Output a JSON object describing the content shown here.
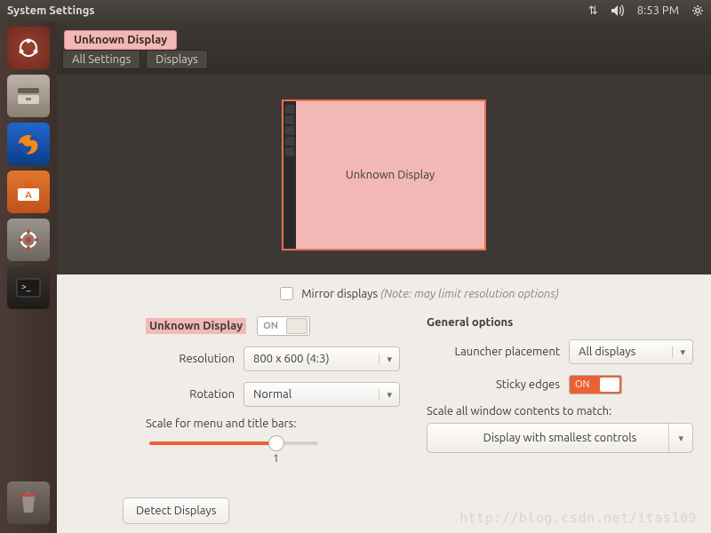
{
  "menubar": {
    "title": "System Settings",
    "time": "8:53 PM"
  },
  "launcher": {
    "items": [
      "dash",
      "files",
      "firefox",
      "software",
      "settings",
      "terminal"
    ],
    "trash": "trash"
  },
  "window": {
    "badge": "Unknown Display",
    "ghost_title": "Displays",
    "crumbs": [
      "All Settings",
      "Displays"
    ]
  },
  "preview": {
    "display_label": "Unknown Display"
  },
  "mirror": {
    "label": "Mirror displays",
    "note": "(Note: may limit resolution options)"
  },
  "left": {
    "display_name": "Unknown Display",
    "power": "ON",
    "resolution_label": "Resolution",
    "resolution_value": "800 x 600 (4:3)",
    "rotation_label": "Rotation",
    "rotation_value": "Normal",
    "scale_label": "Scale for menu and title bars:",
    "scale_value": "1"
  },
  "right": {
    "header": "General options",
    "launcher_label": "Launcher placement",
    "launcher_value": "All displays",
    "sticky_label": "Sticky edges",
    "sticky_value": "ON",
    "scale_all_label": "Scale all window contents to match:",
    "scale_all_value": "Display with smallest controls"
  },
  "footer": {
    "detect": "Detect Displays"
  },
  "watermark": "http://blog.csdn.net/itas109"
}
